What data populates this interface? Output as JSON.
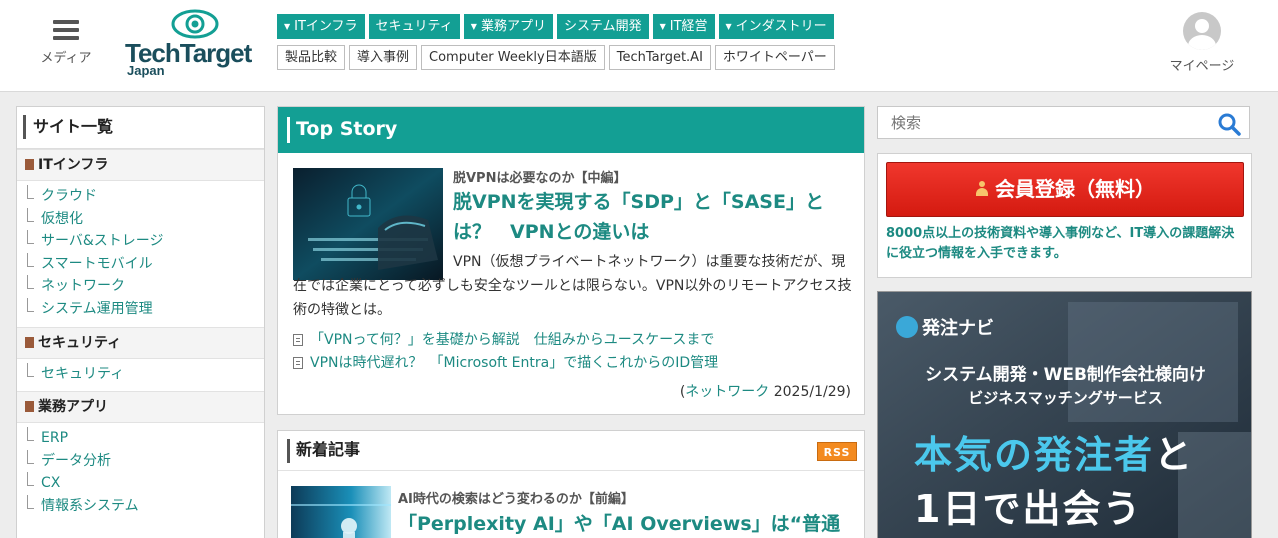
{
  "header": {
    "menu_label": "メディア",
    "logo_text": "TechTarget",
    "logo_sub": "Japan",
    "nav_primary": [
      {
        "label": "ITインフラ",
        "dropdown": true
      },
      {
        "label": "セキュリティ",
        "dropdown": false
      },
      {
        "label": "業務アプリ",
        "dropdown": true
      },
      {
        "label": "システム開発",
        "dropdown": false
      },
      {
        "label": "IT経営",
        "dropdown": true
      },
      {
        "label": "インダストリー",
        "dropdown": true
      }
    ],
    "nav_secondary": [
      "製品比較",
      "導入事例",
      "Computer Weekly日本語版",
      "TechTarget.AI",
      "ホワイトペーパー"
    ],
    "mypage_label": "マイページ"
  },
  "sidebar": {
    "title": "サイト一覧",
    "categories": [
      {
        "label": "ITインフラ",
        "items": [
          "クラウド",
          "仮想化",
          "サーバ&ストレージ",
          "スマートモバイル",
          "ネットワーク",
          "システム運用管理"
        ]
      },
      {
        "label": "セキュリティ",
        "items": [
          "セキュリティ"
        ]
      },
      {
        "label": "業務アプリ",
        "items": [
          "ERP",
          "データ分析",
          "CX",
          "情報系システム"
        ]
      }
    ]
  },
  "top_story": {
    "heading": "Top Story",
    "kicker": "脱VPNは必要なのか【中編】",
    "headline": "脱VPNを実現する「SDP」と「SASE」とは？　VPNとの違いは",
    "description": "VPN（仮想プライベートネットワーク）は重要な技術だが、現在では企業にとって必ずしも安全なツールとは限らない。VPN以外のリモートアクセス技術の特徴とは。",
    "related_links": [
      "「VPNって何？」を基礎から解説　仕組みからユースケースまで",
      "VPNは時代遅れ？　「Microsoft Entra」で描くこれからのID管理"
    ],
    "meta_open": "(",
    "meta_category": "ネットワーク",
    "meta_date": " 2025/1/29)"
  },
  "new_articles": {
    "heading": "新着記事",
    "rss_label": "RSS",
    "kicker": "AI時代の検索はどう変わるのか【前編】",
    "headline": "「Perplexity AI」や「AI Overviews」は“普通"
  },
  "search": {
    "placeholder": "検索"
  },
  "member": {
    "button_label": "会員登録（無料）",
    "description": "8000点以上の技術資料や導入事例など、IT導入の課題解決に役立つ情報を入手できます。"
  },
  "ad": {
    "brand": "発注ナビ",
    "line1": "システム開発・WEB制作会社様向け",
    "line2": "ビジネスマッチングサービス",
    "line3_main": "本気の発注者",
    "line3_tail": "と",
    "line4": "1日で出会う"
  },
  "colors": {
    "accent": "#139f94",
    "link": "#1d8a82",
    "signup": "#e2261c",
    "rss": "#f38a1f"
  }
}
